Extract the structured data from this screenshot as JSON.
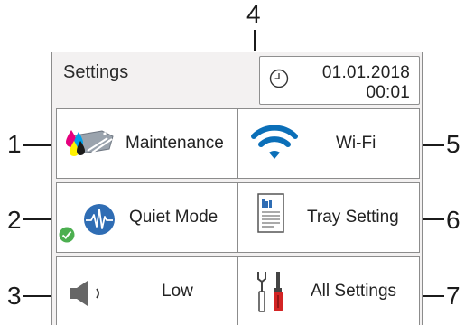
{
  "header": {
    "title": "Settings",
    "date": "01.01.2018",
    "time": "00:01"
  },
  "tiles": [
    {
      "label": "Maintenance",
      "icon": "ink-maintenance-icon"
    },
    {
      "label": "Wi-Fi",
      "icon": "wifi-icon"
    },
    {
      "label": "Quiet Mode",
      "icon": "quiet-mode-icon",
      "status_badge": "check-icon"
    },
    {
      "label": "Tray Setting",
      "icon": "tray-setting-icon"
    },
    {
      "label": "Low",
      "icon": "speaker-volume-icon"
    },
    {
      "label": "All Settings",
      "icon": "tools-icon"
    }
  ],
  "callouts": {
    "c1": "1",
    "c2": "2",
    "c3": "3",
    "c4": "4",
    "c5": "5",
    "c6": "6",
    "c7": "7"
  },
  "colors": {
    "panel_bg": "#f3f1f1",
    "tile_border": "#8c8c8c",
    "wifi_blue": "#0b6fb8",
    "quiet_blue": "#2f6db4",
    "check_green": "#4caf50",
    "tools_red": "#d32424"
  }
}
